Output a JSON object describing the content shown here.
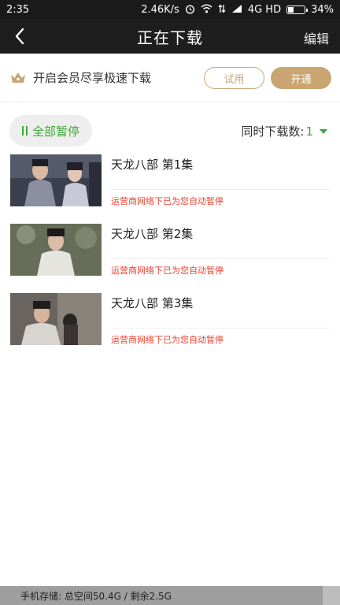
{
  "status_bar": {
    "time": "2:35",
    "speed": "2.46K/s",
    "network": "4G HD",
    "battery": "34%",
    "battery_level": 0.34,
    "icons": [
      "alarm-icon",
      "wifi-icon",
      "data-arrows-icon",
      "signal-icon",
      "battery-icon"
    ]
  },
  "nav": {
    "title": "正在下载",
    "edit_label": "编辑",
    "back_icon": "back-arrow-icon"
  },
  "vip": {
    "icon": "crown-icon",
    "text": "开启会员尽享极速下载",
    "try_label": "试用",
    "open_label": "开通",
    "accent_color": "#caa572"
  },
  "controls": {
    "pause_all_label": "全部暂停",
    "concurrent_label": "同时下载数:",
    "concurrent_value": "1",
    "accent_color": "#3aa935"
  },
  "downloads": [
    {
      "title": "天龙八部 第1集",
      "status": "运营商网络下已为您自动暂停"
    },
    {
      "title": "天龙八部 第2集",
      "status": "运营商网络下已为您自动暂停"
    },
    {
      "title": "天龙八部 第3集",
      "status": "运营商网络下已为您自动暂停"
    }
  ],
  "storage": {
    "text": "手机存储: 总空间50.4G / 剩余2.5G",
    "used_fraction": 0.95
  }
}
